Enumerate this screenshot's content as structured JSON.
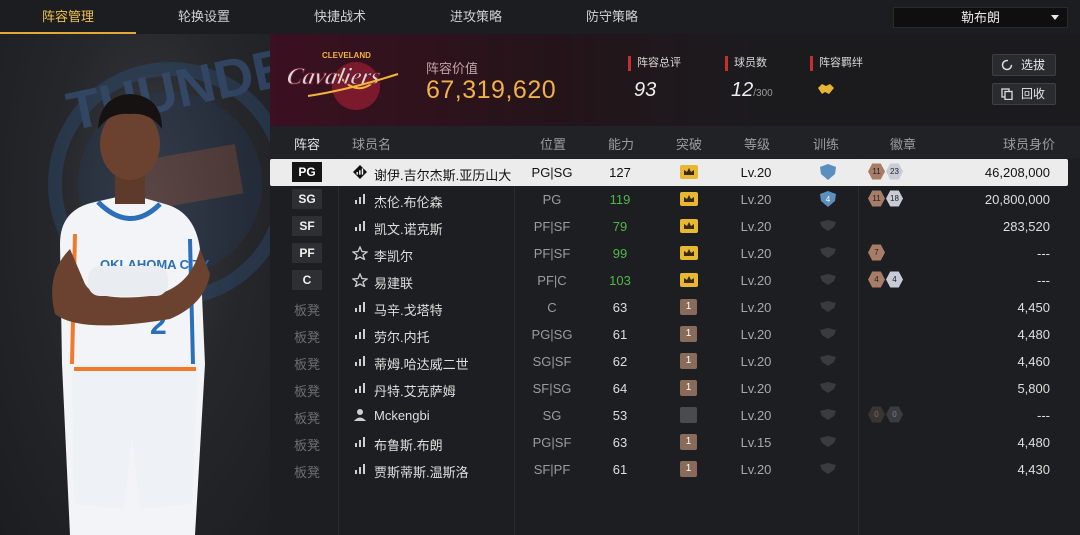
{
  "tabs": [
    {
      "label": "阵容管理",
      "active": true
    },
    {
      "label": "轮换设置",
      "active": false
    },
    {
      "label": "快捷战术",
      "active": false
    },
    {
      "label": "进攻策略",
      "active": false
    },
    {
      "label": "防守策略",
      "active": false
    }
  ],
  "team_select": {
    "value": "勒布朗"
  },
  "header": {
    "team_logo": "Cavaliers",
    "logo_top_text": "CLEVELAND",
    "lineup_value_label": "阵容价值",
    "lineup_value": "67,319,620",
    "stats": [
      {
        "label": "阵容总评",
        "value": "93"
      },
      {
        "label": "球员数",
        "value": "12",
        "suffix": "/300"
      },
      {
        "label": "阵容羁绊",
        "value": ""
      }
    ],
    "buttons": [
      {
        "label": "选拔",
        "icon": "refresh-icon"
      },
      {
        "label": "回收",
        "icon": "copy-icon"
      }
    ]
  },
  "table": {
    "headers": [
      "阵容",
      "球员名",
      "位置",
      "能力",
      "突破",
      "等级",
      "训练",
      "徽章",
      "球员身价"
    ],
    "rows": [
      {
        "slot": "PG",
        "name": "谢伊.吉尔杰斯.亚历山大",
        "position": "PG|SG",
        "ability": "127",
        "ability_green": false,
        "breakthrough": "crown",
        "level": "Lv.20",
        "training": "",
        "badges": [
          "11",
          "23"
        ],
        "salary": "46,208,000",
        "selected": true
      },
      {
        "slot": "SG",
        "name": "杰伦.布伦森",
        "position": "PG",
        "ability": "119",
        "ability_green": true,
        "breakthrough": "crown",
        "level": "Lv.20",
        "training": "4",
        "badges": [
          "11",
          "18"
        ],
        "salary": "20,800,000",
        "selected": false
      },
      {
        "slot": "SF",
        "name": "凯文.诺克斯",
        "position": "PF|SF",
        "ability": "79",
        "ability_green": true,
        "breakthrough": "crown",
        "level": "Lv.20",
        "training": "",
        "badges": [],
        "salary": "283,520",
        "selected": false
      },
      {
        "slot": "PF",
        "name": "李凯尔",
        "position": "PF|SF",
        "ability": "99",
        "ability_green": true,
        "breakthrough": "crown",
        "level": "Lv.20",
        "training": "",
        "badges": [
          "7"
        ],
        "salary": "---",
        "selected": false
      },
      {
        "slot": "C",
        "name": "易建联",
        "position": "PF|C",
        "ability": "103",
        "ability_green": true,
        "breakthrough": "crown",
        "level": "Lv.20",
        "training": "",
        "badges": [
          "4",
          "4"
        ],
        "salary": "---",
        "selected": false
      },
      {
        "slot": "板凳",
        "name": "马辛.戈塔特",
        "position": "C",
        "ability": "63",
        "ability_green": false,
        "breakthrough": "1",
        "level": "Lv.20",
        "training": "",
        "badges": [],
        "salary": "4,450",
        "selected": false
      },
      {
        "slot": "板凳",
        "name": "劳尔.内托",
        "position": "PG|SG",
        "ability": "61",
        "ability_green": false,
        "breakthrough": "1",
        "level": "Lv.20",
        "training": "",
        "badges": [],
        "salary": "4,480",
        "selected": false
      },
      {
        "slot": "板凳",
        "name": "蒂姆.哈达威二世",
        "position": "SG|SF",
        "ability": "62",
        "ability_green": false,
        "breakthrough": "1",
        "level": "Lv.20",
        "training": "",
        "badges": [],
        "salary": "4,460",
        "selected": false
      },
      {
        "slot": "板凳",
        "name": "丹特.艾克萨姆",
        "position": "SF|SG",
        "ability": "64",
        "ability_green": false,
        "breakthrough": "1",
        "level": "Lv.20",
        "training": "",
        "badges": [],
        "salary": "5,800",
        "selected": false
      },
      {
        "slot": "板凳",
        "name": "Mckengbi",
        "position": "SG",
        "ability": "53",
        "ability_green": false,
        "breakthrough": "",
        "level": "Lv.20",
        "training": "",
        "badges": [
          "0",
          "0"
        ],
        "salary": "---",
        "selected": false
      },
      {
        "slot": "板凳",
        "name": "布鲁斯.布朗",
        "position": "PG|SF",
        "ability": "63",
        "ability_green": false,
        "breakthrough": "1",
        "level": "Lv.15",
        "training": "",
        "badges": [],
        "salary": "4,480",
        "selected": false
      },
      {
        "slot": "板凳",
        "name": "贾斯蒂斯.温斯洛",
        "position": "SF|PF",
        "ability": "61",
        "ability_green": false,
        "breakthrough": "1",
        "level": "Lv.20",
        "training": "",
        "badges": [],
        "salary": "4,430",
        "selected": false
      }
    ]
  },
  "player_card": {
    "team_text": "THUNDER",
    "jersey_text": "OKLAHOMA CITY",
    "jersey_number": "2"
  },
  "colors": {
    "accent": "#e0a93a",
    "value": "#f0b04a",
    "green": "#4fb64a",
    "red": "#c43030"
  }
}
